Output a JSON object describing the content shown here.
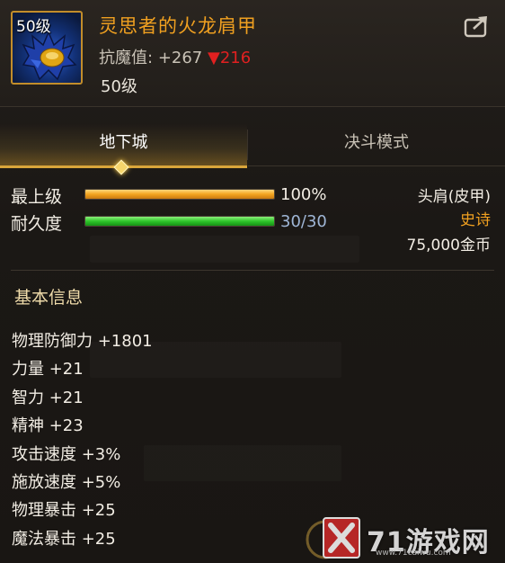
{
  "item": {
    "icon_level": "50级",
    "name": "灵思者的火龙肩甲",
    "stat_label": "抗魔值:",
    "stat_value": "+267",
    "stat_arrow": "▼",
    "stat_down": "216",
    "level_text": "50级"
  },
  "tabs": [
    {
      "label": "地下城",
      "selected": true
    },
    {
      "label": "决斗模式",
      "selected": false
    }
  ],
  "bars": {
    "max_level": {
      "label": "最上级",
      "value_text": "100%",
      "fraction": 1.0
    },
    "durability": {
      "label": "耐久度",
      "value_text": "30/30",
      "fraction": 1.0
    }
  },
  "info": {
    "slot": "头肩(皮甲)",
    "rarity": "史诗",
    "price": "75,000金币"
  },
  "basic": {
    "title": "基本信息",
    "attributes": [
      "物理防御力 +1801",
      "力量 +21",
      "智力 +21",
      "精神 +23",
      "攻击速度 +3%",
      "施放速度 +5%",
      "物理暴击 +25",
      "魔法暴击 +25"
    ]
  },
  "watermark": {
    "text": "71游戏网",
    "url": "www.71caiwu.com"
  },
  "colors": {
    "name": "#f0a020",
    "rarity_epic": "#f0a020",
    "stat_down": "#e02020",
    "tab_active_underline": "#d9a53a"
  }
}
